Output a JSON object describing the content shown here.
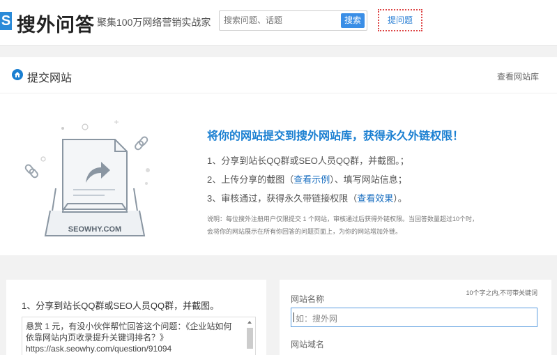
{
  "header": {
    "logo_mark": "S",
    "logo_text": "搜外问答",
    "slogan": "聚集100万网络营销实战家",
    "search_placeholder": "搜索问题、话题",
    "search_button": "搜索",
    "ask_button": "提问题"
  },
  "titlebar": {
    "title": "提交网站",
    "view_library": "查看网站库"
  },
  "intro": {
    "illustration_caption": "SEOWHY.COM",
    "heading": "将你的网站提交到搜外网站库，获得永久外链权限！",
    "step1": "1、分享到站长QQ群或SEO人员QQ群，并截图。；",
    "step2_prefix": "2、上传分享的截图（",
    "step2_link": "查看示例",
    "step2_suffix": "）、填写网站信息；",
    "step3_prefix": "3、审核通过，获得永久带链接权限（",
    "step3_link": "查看效果",
    "step3_suffix": "）。",
    "note_line1": "说明：每位搜外注册用户仅限提交 1 个网站，审核通过后获得外链权限。当回答数量超过10个时，",
    "note_line2": "会将你的网站展示在所有你回答的问题页面上，为你的网站增加外链。"
  },
  "share": {
    "title": "1、分享到站长QQ群或SEO人员QQ群，并截图。",
    "text_line1": "悬赏 1 元，有没小伙伴帮忙回答这个问题：《企业站如何",
    "text_line2": "依靠网站内页收录提升关键词排名？》",
    "text_line3": "https://ask.seowhy.com/question/91094"
  },
  "form": {
    "hint": "10个字之内,不可带关键词",
    "name_label": "网站名称",
    "name_placeholder": "如：搜外网",
    "domain_label": "网站域名"
  },
  "colors": {
    "brand_blue": "#1a7fd1",
    "button_blue": "#3a8ee6",
    "ask_border_red": "#dd4444"
  }
}
